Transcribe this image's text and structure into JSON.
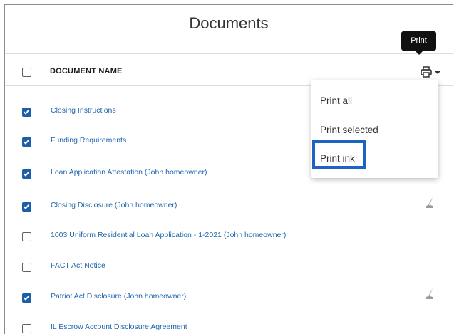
{
  "panel": {
    "title": "Documents"
  },
  "table": {
    "column_header": "DOCUMENT NAME",
    "rows": [
      {
        "label": "Closing Instructions",
        "checked": true,
        "signature": false
      },
      {
        "label": "Funding Requirements",
        "checked": true,
        "signature": false
      },
      {
        "label": "Loan Application Attestation (John homeowner)",
        "checked": true,
        "signature": false
      },
      {
        "label": "Closing Disclosure (John homeowner)",
        "checked": true,
        "signature": true
      },
      {
        "label": "1003 Uniform Residential Loan Application - 1-2021 (John homeowner)",
        "checked": false,
        "signature": false
      },
      {
        "label": "FACT Act Notice",
        "checked": false,
        "signature": false
      },
      {
        "label": "Patriot Act Disclosure (John homeowner)",
        "checked": true,
        "signature": true
      },
      {
        "label": "IL Escrow Account Disclosure Agreement",
        "checked": false,
        "signature": false
      }
    ]
  },
  "print": {
    "tooltip": "Print",
    "icon": "printer-icon",
    "menu": [
      "Print all",
      "Print selected",
      "Print ink"
    ]
  },
  "colors": {
    "accent": "#1b5fa8",
    "link": "#1f65ad",
    "highlight": "#1d64c2"
  }
}
